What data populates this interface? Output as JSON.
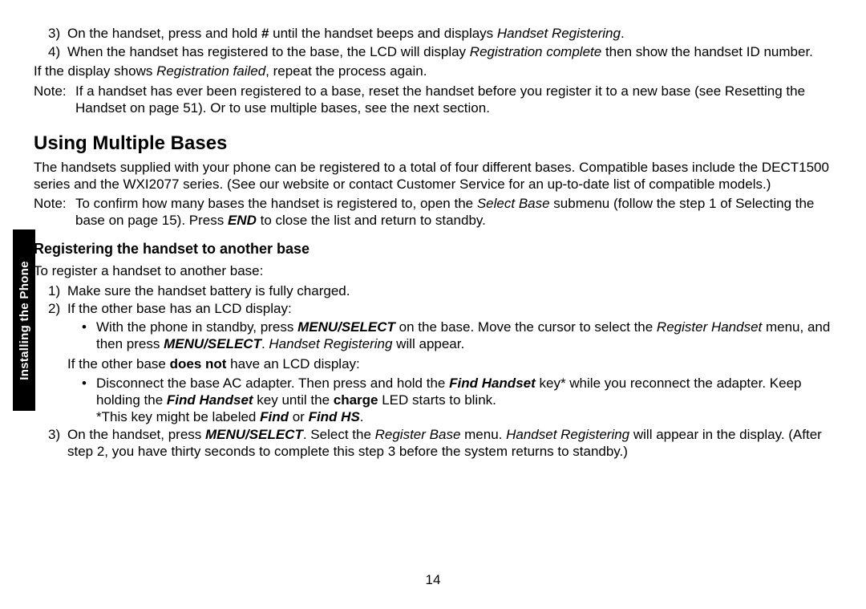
{
  "side_tab": "Installing the Phone",
  "page_number": "14",
  "top_list": {
    "item3_num": "3)",
    "item3_a": "On the handset, press and hold ",
    "item3_b_hash": "#",
    "item3_c": " until the handset beeps and displays ",
    "item3_d_em": "Handset Registering",
    "item3_e": ".",
    "item4_num": "4)",
    "item4_a": "When the handset has registered to the base, the LCD will display ",
    "item4_b_em": "Registration complete",
    "item4_c": " then show the handset ID number."
  },
  "para_fail_a": "If the display shows ",
  "para_fail_b_em": "Registration failed",
  "para_fail_c": ", repeat the process again.",
  "note1_label": "Note:",
  "note1_body": "If a handset has ever been registered to a base, reset the handset before you register it to a new base (see Resetting the Handset on page 51). Or to use multiple bases, see the next section.",
  "h_bases": "Using Multiple Bases",
  "bases_para": "The handsets supplied with your phone can be registered to a total of four different bases. Compatible bases include the DECT1500 series and the WXI2077 series. (See our website or contact Customer Service for an up-to-date list of compatible models.)",
  "note2_label": "Note:",
  "note2_a": "To confirm how many bases the handset is registered to, open the ",
  "note2_b_em": "Select Base",
  "note2_c": " submenu (follow the step 1 of Selecting the base on page 15). Press ",
  "note2_d_bi": "END",
  "note2_e": " to close the list and return to standby.",
  "h_reg": "Registering the handset to another base",
  "reg_intro": "To register a handset to another base:",
  "reg1_num": "1)",
  "reg1_body": "Make sure the handset battery is fully charged.",
  "reg2_num": "2)",
  "reg2_body": "If the other base has an LCD display:",
  "reg2_bullet_a": "With the phone in standby, press ",
  "reg2_bullet_b_bi": "MENU/SELECT",
  "reg2_bullet_c": " on the base. Move the cursor to select the ",
  "reg2_bullet_d_em": "Register Handset",
  "reg2_bullet_e": " menu, and then press ",
  "reg2_bullet_f_bi": "MENU/SELECT",
  "reg2_bullet_g": ". ",
  "reg2_bullet_h_em": "Handset Registering",
  "reg2_bullet_i": " will appear.",
  "reg2_alt_a": "If the other base ",
  "reg2_alt_b_strong": "does not",
  "reg2_alt_c": " have an LCD display:",
  "reg2b_bullet_a": "Disconnect the base AC adapter. Then press and hold the ",
  "reg2b_bullet_b_bi": "Find Handset",
  "reg2b_bullet_c": " key* while you reconnect the adapter. Keep holding the ",
  "reg2b_bullet_d_bi": "Find Handset",
  "reg2b_bullet_e": " key until the ",
  "reg2b_bullet_f_strong": "charge",
  "reg2b_bullet_g": " LED starts to blink.",
  "reg2b_bullet_h_a": "*This key might be labeled ",
  "reg2b_bullet_h_b_bi": "Find",
  "reg2b_bullet_h_c": " or ",
  "reg2b_bullet_h_d_bi": "Find HS",
  "reg2b_bullet_h_e": ".",
  "reg3_num": "3)",
  "reg3_a": "On the handset, press ",
  "reg3_b_bi": "MENU/SELECT",
  "reg3_c": ". Select the ",
  "reg3_d_em": "Register Base",
  "reg3_e": " menu. ",
  "reg3_f_em": "Handset Registering",
  "reg3_g": " will appear in the display. (After step 2, you have thirty seconds to complete this step 3 before the system returns to standby.)",
  "bullet_char": "•"
}
